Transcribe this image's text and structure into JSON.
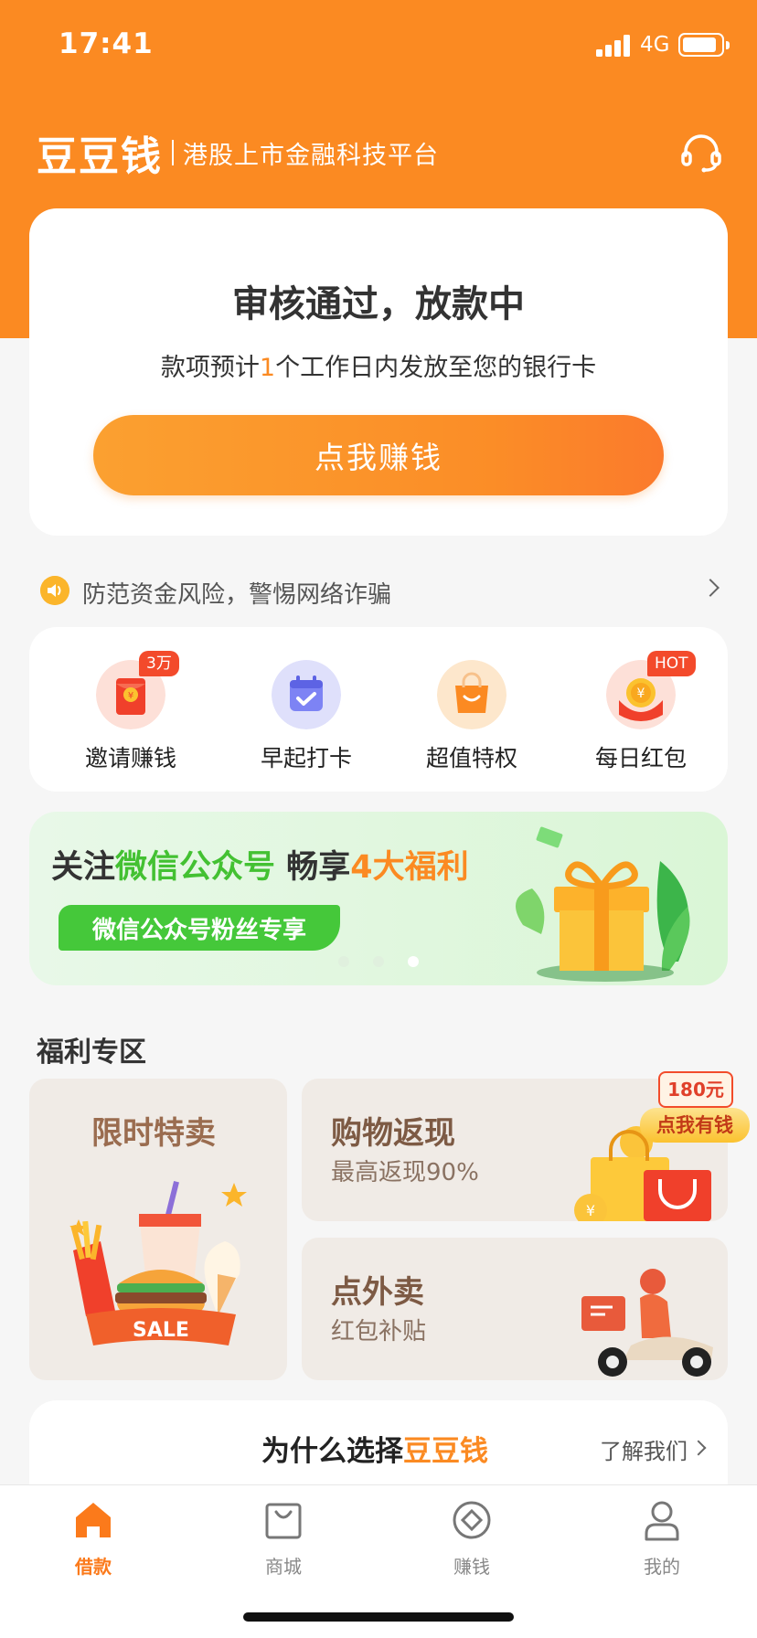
{
  "status_bar": {
    "time": "17:41",
    "network": "4G"
  },
  "header": {
    "logo": "豆豆钱",
    "tagline": "港股上市金融科技平台"
  },
  "status_card": {
    "title": "审核通过，放款中",
    "sub_prefix": "款项预计",
    "sub_highlight": "1",
    "sub_suffix": "个工作日内发放至您的银行卡",
    "cta_label": "点我赚钱"
  },
  "notice": {
    "text": "防范资金风险，警惕网络诈骗"
  },
  "quick_actions": [
    {
      "label": "邀请赚钱",
      "badge": "3万",
      "icon": "red-envelope-icon"
    },
    {
      "label": "早起打卡",
      "badge": "",
      "icon": "calendar-check-icon"
    },
    {
      "label": "超值特权",
      "badge": "",
      "icon": "shopping-bag-icon"
    },
    {
      "label": "每日红包",
      "badge": "HOT",
      "icon": "coin-icon"
    }
  ],
  "banner": {
    "title_a": "关注",
    "title_b": "微信公众号",
    "title_c": " 畅享",
    "title_d": "4大福利",
    "pill": "微信公众号粉丝专享",
    "active_dot": 2,
    "dot_count": 3
  },
  "welfare": {
    "section_title": "福利专区",
    "limited": {
      "title": "限时特卖",
      "image_text": "SALE"
    },
    "cashback": {
      "title": "购物返现",
      "sub": "最高返现90%",
      "tag_amount": "180元",
      "tag_label": "点我有钱"
    },
    "takeout": {
      "title": "点外卖",
      "sub": "红包补贴"
    }
  },
  "why": {
    "title_prefix": "为什么选择",
    "title_brand": "豆豆钱",
    "link": "了解我们"
  },
  "tabs": [
    {
      "label": "借款",
      "icon": "home-icon",
      "active": true
    },
    {
      "label": "商城",
      "icon": "shop-bag-icon",
      "active": false
    },
    {
      "label": "赚钱",
      "icon": "diamond-coin-icon",
      "active": false
    },
    {
      "label": "我的",
      "icon": "person-icon",
      "active": false
    }
  ],
  "colors": {
    "primary": "#fb8a22",
    "green": "#43c132",
    "badge_red": "#f34a2b"
  }
}
